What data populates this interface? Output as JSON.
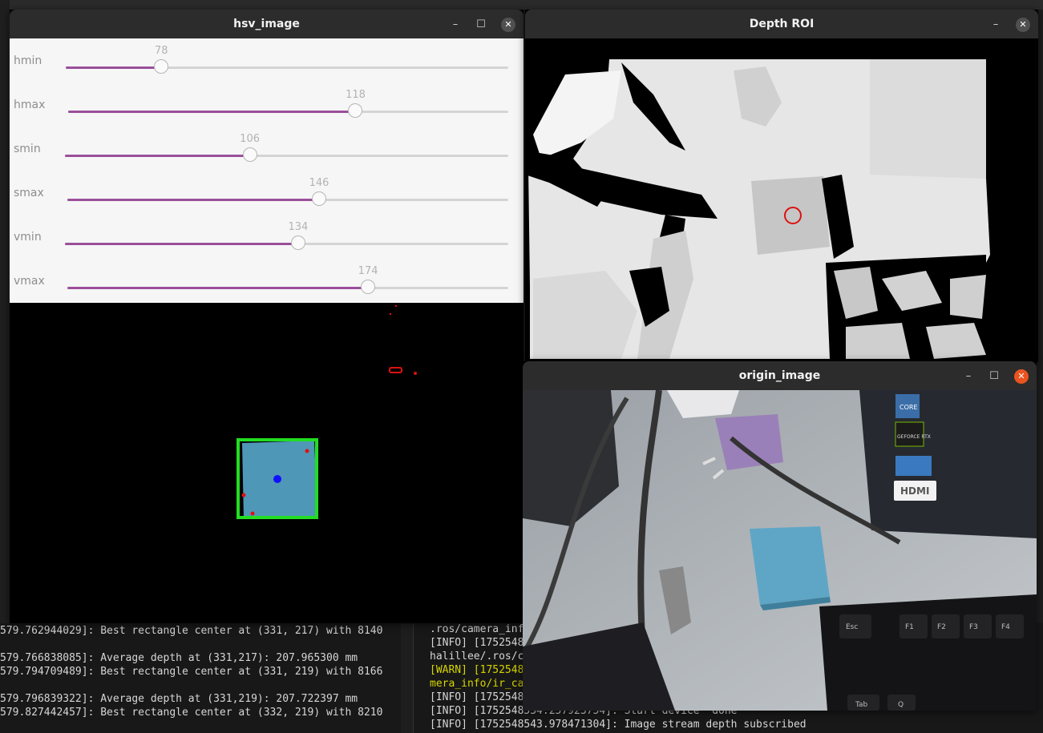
{
  "windows": {
    "hsv": {
      "title": "hsv_image",
      "trackbars": [
        {
          "name": "hmin",
          "value": "78",
          "fraction": 0.216
        },
        {
          "name": "hmax",
          "value": "118",
          "fraction": 0.653
        },
        {
          "name": "smin",
          "value": "106",
          "fraction": 0.417
        },
        {
          "name": "smax",
          "value": "146",
          "fraction": 0.571
        },
        {
          "name": "vmin",
          "value": "134",
          "fraction": 0.526
        },
        {
          "name": "vmax",
          "value": "174",
          "fraction": 0.682
        }
      ]
    },
    "depth": {
      "title": "Depth ROI"
    },
    "origin": {
      "title": "origin_image",
      "laptop_label": "HDMI",
      "laptop_badges": [
        "CORE",
        "GEFORCE RTX"
      ],
      "key_labels": [
        "Esc",
        "F1",
        "F2",
        "F3",
        "F4",
        "Tab",
        "Q"
      ]
    }
  },
  "terminal_left": {
    "lines": [
      "579.762944029]: Best rectangle center at (331, 217) with 8140",
      "",
      "579.766838085]: Average depth at (331,217): 207.965300 mm",
      "579.794709489]: Best rectangle center at (331, 219) with 8166",
      "",
      "579.796839322]: Average depth at (331,219): 207.722397 mm",
      "579.827442457]: Best rectangle center at (332, 219) with 8210"
    ]
  },
  "terminal_right": {
    "lines": [
      {
        "text": ".ros/camera_inf",
        "level": "info"
      },
      {
        "text": "[INFO] [1752548",
        "level": "info"
      },
      {
        "text": "halillee/.ros/c",
        "level": "info"
      },
      {
        "text": "[WARN] [1752548",
        "level": "warn"
      },
      {
        "text": "mera_info/ir_ca",
        "level": "warn"
      },
      {
        "text": "[INFO] [1752548",
        "level": "info"
      },
      {
        "text": "[INFO] [1752548534.257923754]: Start device  done",
        "level": "info"
      },
      {
        "text": "[INFO] [1752548543.978471304]: Image stream depth subscribed",
        "level": "info"
      }
    ]
  },
  "colors": {
    "accent": "#e95420",
    "trackbar_fill": "#9a4f9a",
    "detect_box": "#22dd22",
    "detect_center": "#1010ff",
    "roi_marker": "#dd1111",
    "warn_text": "#d6d600"
  }
}
